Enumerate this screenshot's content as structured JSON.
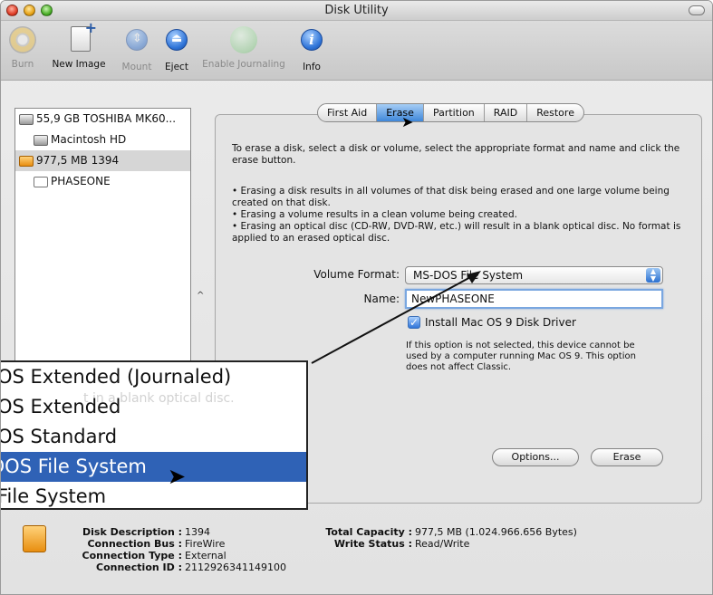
{
  "window": {
    "title": "Disk Utility"
  },
  "toolbar": {
    "items": [
      {
        "label": "Burn",
        "icon": "burn-icon",
        "enabled": false
      },
      {
        "label": "New Image",
        "icon": "new-image-icon",
        "enabled": true
      },
      {
        "label": "Mount",
        "icon": "mount-icon",
        "enabled": false
      },
      {
        "label": "Eject",
        "icon": "eject-icon",
        "enabled": true
      },
      {
        "label": "Enable Journaling",
        "icon": "journaling-icon",
        "enabled": false
      },
      {
        "label": "Info",
        "icon": "info-icon",
        "enabled": true
      }
    ]
  },
  "sidebar": {
    "items": [
      {
        "label": "55,9 GB TOSHIBA MK60...",
        "level": 0,
        "selected": false
      },
      {
        "label": "Macintosh HD",
        "level": 1,
        "selected": false
      },
      {
        "label": "977,5 MB 1394",
        "level": 0,
        "selected": true
      },
      {
        "label": "PHASEONE",
        "level": 1,
        "selected": false
      }
    ],
    "scroll_arrow": "^"
  },
  "tabs": [
    {
      "label": "First Aid",
      "active": false
    },
    {
      "label": "Erase",
      "active": true
    },
    {
      "label": "Partition",
      "active": false
    },
    {
      "label": "RAID",
      "active": false
    },
    {
      "label": "Restore",
      "active": false
    }
  ],
  "erase": {
    "intro": "To erase a disk, select a disk or volume, select the appropriate format and name and click the erase button.",
    "bullets": [
      "• Erasing a disk results in all volumes of that disk being erased and one large volume being created on that disk.",
      "• Erasing a volume results in a clean volume being created.",
      "• Erasing an optical disc (CD-RW, DVD-RW, etc.) will result in a blank optical disc.  No format is applied to an erased optical disc."
    ],
    "volume_format_label": "Volume Format:",
    "volume_format_value": "MS-DOS File System",
    "name_label": "Name:",
    "name_value": "NewPHASEONE",
    "install_driver_label": "Install Mac OS 9 Disk Driver",
    "install_driver_checked": true,
    "install_driver_note": "If this option is not selected, this device cannot be used by a computer running Mac OS 9.  This option does not affect Classic.",
    "options_button": "Options...",
    "erase_button": "Erase"
  },
  "popup": {
    "options": [
      "OS Extended (Journaled)",
      "OS Extended",
      "OS Standard",
      "OS File System",
      "File System"
    ],
    "selected_index": 3,
    "ghost_text": "t in a blank optical disc."
  },
  "info": {
    "disk_description_label": "Disk Description :",
    "disk_description_value": "1394",
    "connection_bus_label": "Connection Bus :",
    "connection_bus_value": "FireWire",
    "connection_type_label": "Connection Type :",
    "connection_type_value": "External",
    "connection_id_label": "Connection ID :",
    "connection_id_value": "2112926341149100",
    "total_capacity_label": "Total Capacity :",
    "total_capacity_value": "977,5 MB (1.024.966.656 Bytes)",
    "write_status_label": "Write Status :",
    "write_status_value": "Read/Write"
  },
  "colors": {
    "selection_blue": "#2f62b6",
    "tab_active": "#3f87d9",
    "disk_orange": "#e88e10"
  }
}
